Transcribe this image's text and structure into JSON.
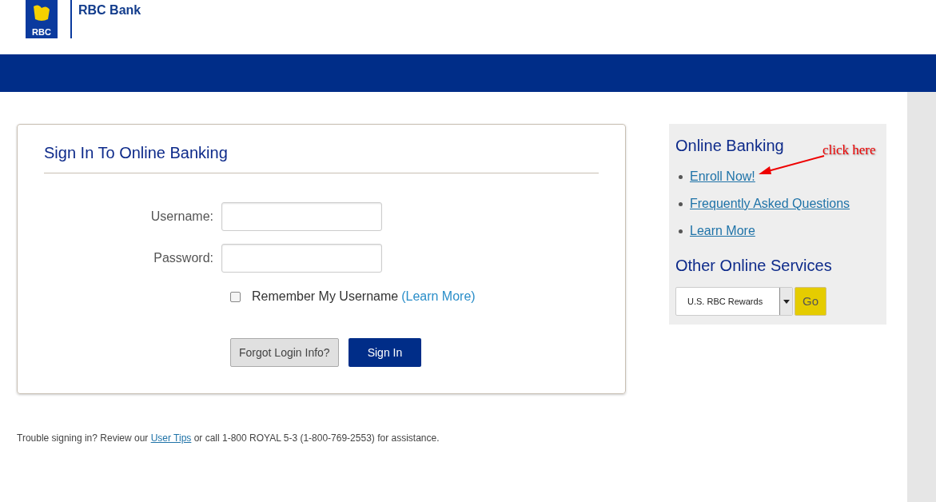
{
  "header": {
    "logo_text": "RBC",
    "brand": "RBC Bank"
  },
  "sign_in": {
    "title": "Sign In To Online Banking",
    "fields": [
      {
        "label": "Username:"
      },
      {
        "label": "Password:"
      }
    ],
    "remember": {
      "label": "Remember My Username",
      "link": "(Learn More)",
      "checked": false
    },
    "buttons": [
      {
        "label": "Forgot Login Info?",
        "kind": "secondary"
      },
      {
        "label": "Sign In",
        "kind": "primary"
      }
    ]
  },
  "footer": {
    "before": "Trouble signing in? Review our ",
    "link": "User Tips",
    "after": " or call 1-800 ROYAL 5-3 (1-800-769-2553) for assistance."
  },
  "sidebar": {
    "title": "Online Banking",
    "links": [
      "Enroll Now!",
      "Frequently Asked Questions",
      "Learn More"
    ],
    "services_title": "Other Online Services",
    "select_value": "U.S. RBC Rewards",
    "go": "Go"
  },
  "annotation": {
    "text": "click here"
  }
}
